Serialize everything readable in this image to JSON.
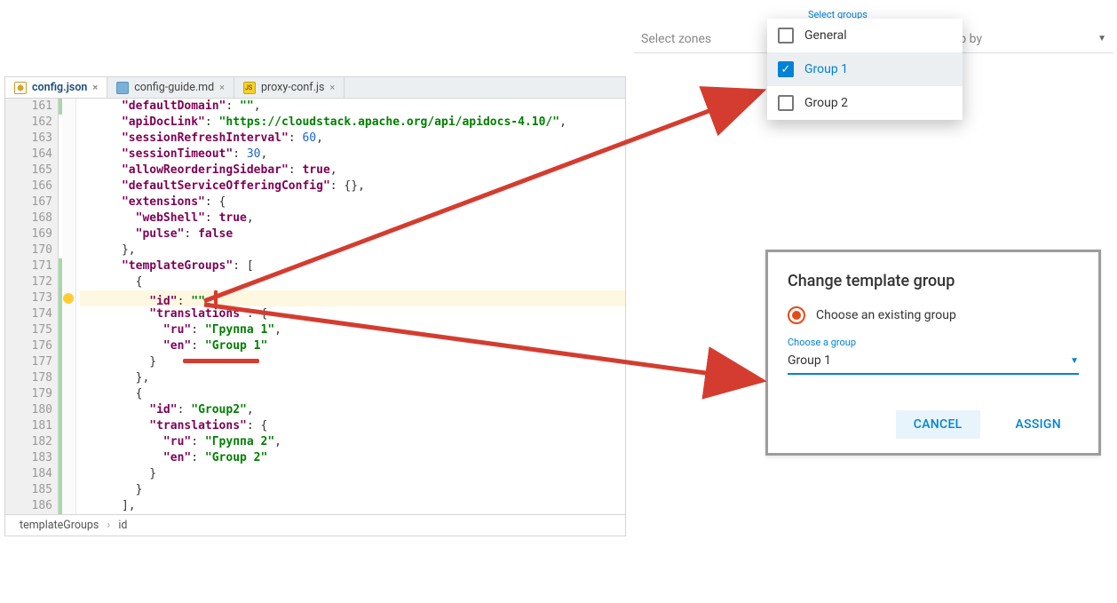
{
  "editor": {
    "tabs": [
      {
        "label": "config.json",
        "icon": "icon-json",
        "active": true
      },
      {
        "label": "config-guide.md",
        "icon": "icon-md",
        "active": false
      },
      {
        "label": "proxy-conf.js",
        "icon": "icon-js",
        "active": false
      }
    ],
    "lineStart": 161,
    "lineEnd": 186,
    "breadcrumb": {
      "a": "templateGroups",
      "b": "id"
    },
    "code_tokens": [
      [
        [
          "k",
          "\"defaultDomain\""
        ],
        [
          "p",
          ": "
        ],
        [
          "s",
          "\"\""
        ],
        [
          "p",
          ","
        ]
      ],
      [
        [
          "k",
          "\"apiDocLink\""
        ],
        [
          "p",
          ": "
        ],
        [
          "s",
          "\"https://cloudstack.apache.org/api/apidocs-4.10/\""
        ],
        [
          "p",
          ","
        ]
      ],
      [
        [
          "k",
          "\"sessionRefreshInterval\""
        ],
        [
          "p",
          ": "
        ],
        [
          "n",
          "60"
        ],
        [
          "p",
          ","
        ]
      ],
      [
        [
          "k",
          "\"sessionTimeout\""
        ],
        [
          "p",
          ": "
        ],
        [
          "n",
          "30"
        ],
        [
          "p",
          ","
        ]
      ],
      [
        [
          "k",
          "\"allowReorderingSidebar\""
        ],
        [
          "p",
          ": "
        ],
        [
          "b",
          "true"
        ],
        [
          "p",
          ","
        ]
      ],
      [
        [
          "k",
          "\"defaultServiceOfferingConfig\""
        ],
        [
          "p",
          ": {},"
        ]
      ],
      [
        [
          "k",
          "\"extensions\""
        ],
        [
          "p",
          ": {"
        ]
      ],
      [
        [
          "k",
          "\"webShell\""
        ],
        [
          "p",
          ": "
        ],
        [
          "b",
          "true"
        ],
        [
          "p",
          ","
        ]
      ],
      [
        [
          "k",
          "\"pulse\""
        ],
        [
          "p",
          ": "
        ],
        [
          "b",
          "false"
        ]
      ],
      [
        [
          "p",
          "},"
        ]
      ],
      [
        [
          "k",
          "\"templateGroups\""
        ],
        [
          "p",
          ": ["
        ]
      ],
      [
        [
          "p",
          "{"
        ]
      ],
      [
        [
          "k",
          "\"id\""
        ],
        [
          "p",
          ": "
        ],
        [
          "s",
          "\"\""
        ],
        [
          "p",
          ","
        ],
        [
          "caret",
          ""
        ]
      ],
      [
        [
          "k",
          "\"translations\""
        ],
        [
          "p",
          ": {"
        ]
      ],
      [
        [
          "k",
          "\"ru\""
        ],
        [
          "p",
          ": "
        ],
        [
          "s",
          "\"Группа 1\""
        ],
        [
          "p",
          ","
        ]
      ],
      [
        [
          "k",
          "\"en\""
        ],
        [
          "p",
          ": "
        ],
        [
          "s",
          "\"Group 1\""
        ]
      ],
      [
        [
          "p",
          "}"
        ]
      ],
      [
        [
          "p",
          "},"
        ]
      ],
      [
        [
          "p",
          "{"
        ]
      ],
      [
        [
          "k",
          "\"id\""
        ],
        [
          "p",
          ": "
        ],
        [
          "s",
          "\"Group2\""
        ],
        [
          "p",
          ","
        ]
      ],
      [
        [
          "k",
          "\"translations\""
        ],
        [
          "p",
          ": {"
        ]
      ],
      [
        [
          "k",
          "\"ru\""
        ],
        [
          "p",
          ": "
        ],
        [
          "s",
          "\"Группа 2\""
        ],
        [
          "p",
          ","
        ]
      ],
      [
        [
          "k",
          "\"en\""
        ],
        [
          "p",
          ": "
        ],
        [
          "s",
          "\"Group 2\""
        ]
      ],
      [
        [
          "p",
          "}"
        ]
      ],
      [
        [
          "p",
          "}"
        ]
      ],
      [
        [
          "p",
          "],"
        ]
      ]
    ],
    "indents": [
      3,
      3,
      3,
      3,
      3,
      3,
      3,
      4,
      4,
      3,
      3,
      4,
      5,
      5,
      6,
      6,
      5,
      4,
      4,
      5,
      5,
      6,
      6,
      5,
      4,
      3
    ]
  },
  "filter": {
    "zones_placeholder": "Select zones",
    "groupby_label": "Group by",
    "select_groups_label": "Select groups",
    "options": [
      {
        "label": "General",
        "checked": false,
        "selected": false
      },
      {
        "label": "Group 1",
        "checked": true,
        "selected": true
      },
      {
        "label": "Group 2",
        "checked": false,
        "selected": false
      }
    ]
  },
  "modal": {
    "title": "Change template group",
    "radio_label": "Choose an existing group",
    "field_label": "Choose a group",
    "field_value": "Group 1",
    "cancel": "CANCEL",
    "assign": "ASSIGN"
  }
}
